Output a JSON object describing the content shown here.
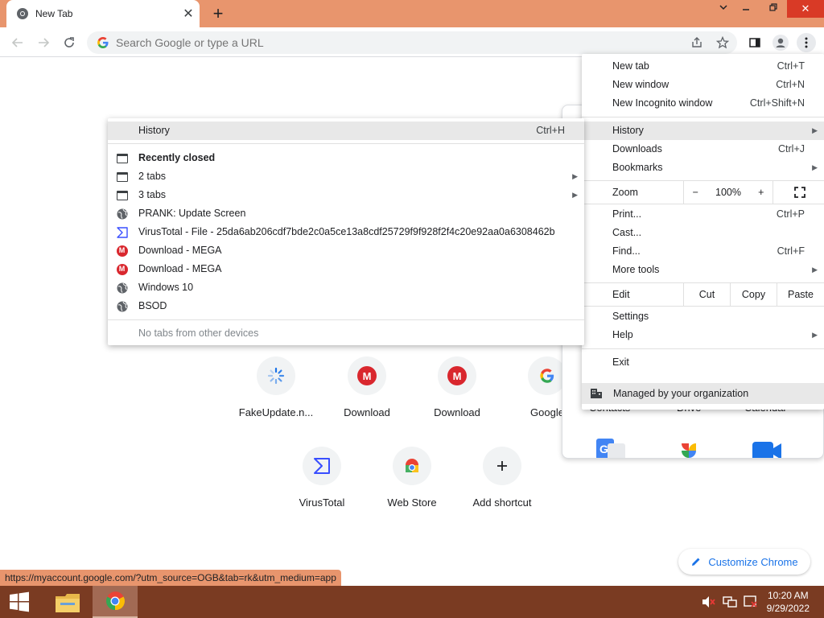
{
  "tab": {
    "title": "New Tab",
    "close": "✕"
  },
  "titlebar": {
    "new_tab": "+",
    "dropdown": "⌄",
    "restore": "❐",
    "minimize": "—",
    "close": "✕"
  },
  "toolbar": {
    "omnibox_placeholder": "Search Google or type a URL"
  },
  "shortcuts_row1": [
    {
      "label": "FakeUpdate.n...",
      "icon": "loading-icon"
    },
    {
      "label": "Download",
      "icon": "mega-icon"
    },
    {
      "label": "Download",
      "icon": "mega-icon"
    },
    {
      "label": "Google",
      "icon": "google-icon"
    }
  ],
  "shortcuts_row2": [
    {
      "label": "VirusTotal",
      "icon": "virustotal-icon"
    },
    {
      "label": "Web Store",
      "icon": "webstore-icon"
    },
    {
      "label": "Add shortcut",
      "icon": "plus-icon"
    }
  ],
  "apps_panel": {
    "labels": [
      "Contacts",
      "Drive",
      "Calendar"
    ]
  },
  "customize": {
    "label": "Customize Chrome"
  },
  "status_url": "https://myaccount.google.com/?utm_source=OGB&tab=rk&utm_medium=app",
  "menu": {
    "new_tab": "New tab",
    "new_tab_sc": "Ctrl+T",
    "new_window": "New window",
    "new_window_sc": "Ctrl+N",
    "incognito": "New Incognito window",
    "incognito_sc": "Ctrl+Shift+N",
    "history": "History",
    "downloads": "Downloads",
    "downloads_sc": "Ctrl+J",
    "bookmarks": "Bookmarks",
    "zoom": "Zoom",
    "zoom_minus": "−",
    "zoom_value": "100%",
    "zoom_plus": "+",
    "print": "Print...",
    "print_sc": "Ctrl+P",
    "cast": "Cast...",
    "find": "Find...",
    "find_sc": "Ctrl+F",
    "more_tools": "More tools",
    "edit": "Edit",
    "cut": "Cut",
    "copy": "Copy",
    "paste": "Paste",
    "settings": "Settings",
    "help": "Help",
    "exit": "Exit",
    "managed": "Managed by your organization"
  },
  "history_menu": {
    "history": "History",
    "history_sc": "Ctrl+H",
    "recently_closed": "Recently closed",
    "items": [
      {
        "label": "2 tabs",
        "icon": "window-icon",
        "submenu": true
      },
      {
        "label": "3 tabs",
        "icon": "window-icon",
        "submenu": true
      },
      {
        "label": "PRANK: Update Screen",
        "icon": "globe-icon",
        "submenu": false
      },
      {
        "label": "VirusTotal - File - 25da6ab206cdf7bde2c0a5ce13a8cdf25729f9f928f2f4c20e92aa0a6308462b",
        "icon": "virustotal-icon",
        "submenu": false
      },
      {
        "label": "Download - MEGA",
        "icon": "mega-icon",
        "submenu": false
      },
      {
        "label": "Download - MEGA",
        "icon": "mega-icon",
        "submenu": false
      },
      {
        "label": "Windows 10",
        "icon": "globe-icon",
        "submenu": false
      },
      {
        "label": "BSOD",
        "icon": "globe-icon",
        "submenu": false
      }
    ],
    "no_tabs": "No tabs from other devices"
  },
  "taskbar": {
    "time": "10:20 AM",
    "date": "9/29/2022"
  },
  "colors": {
    "titlebar": "#e8956d",
    "taskbar": "#7a3b22",
    "accent": "#1a73e8",
    "mega_red": "#d9272e"
  }
}
